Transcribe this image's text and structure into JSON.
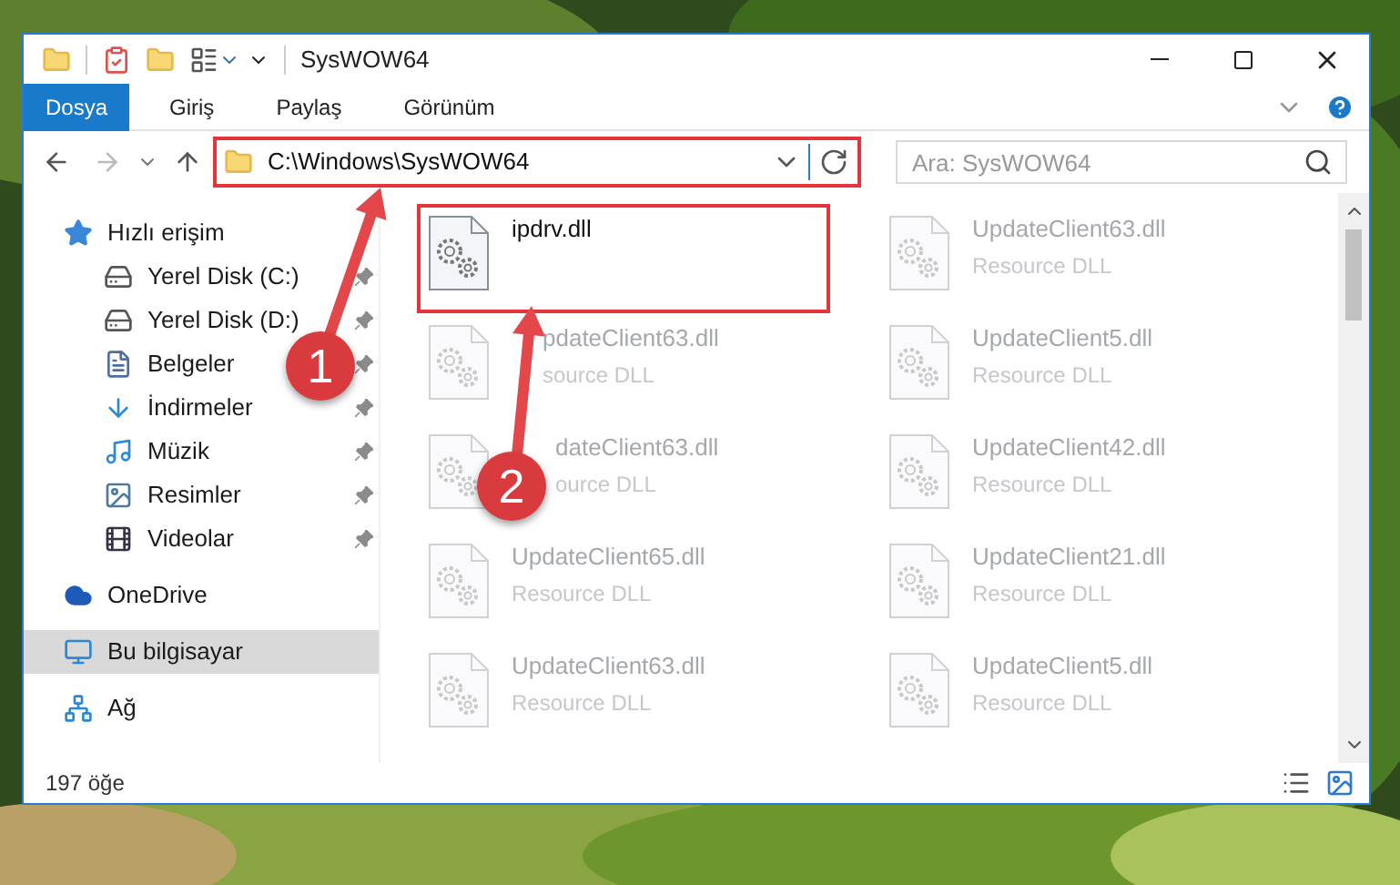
{
  "window": {
    "title": "SysWOW64"
  },
  "ribbon_tabs": [
    {
      "label": "Dosya",
      "selected": true
    },
    {
      "label": "Giriş",
      "selected": false
    },
    {
      "label": "Paylaş",
      "selected": false
    },
    {
      "label": "Görünüm",
      "selected": false
    }
  ],
  "address": {
    "path": "C:\\Windows\\SysWOW64",
    "highlighted": true
  },
  "search": {
    "placeholder": "Ara: SysWOW64"
  },
  "sidebar": {
    "items": [
      {
        "label": "Hızlı erişim",
        "kind": "star",
        "selected": false,
        "children": [
          {
            "label": "Yerel Disk (C:)",
            "kind": "drive_c",
            "selected": false,
            "pinned": true
          },
          {
            "label": "Yerel Disk (D:)",
            "kind": "drive",
            "selected": false,
            "pinned": true
          },
          {
            "label": "Belgeler",
            "kind": "documents",
            "selected": false,
            "pinned": true
          },
          {
            "label": "İndirmeler",
            "kind": "downloads",
            "selected": false,
            "pinned": true
          },
          {
            "label": "Müzik",
            "kind": "music",
            "selected": false,
            "pinned": true
          },
          {
            "label": "Resimler",
            "kind": "pictures",
            "selected": false,
            "pinned": true
          },
          {
            "label": "Videolar",
            "kind": "videos",
            "selected": false,
            "pinned": true
          }
        ]
      },
      {
        "label": "OneDrive",
        "kind": "cloud",
        "selected": false
      },
      {
        "label": "Bu bilgisayar",
        "kind": "computer",
        "selected": true
      },
      {
        "label": "Ağ",
        "kind": "network",
        "selected": false
      }
    ]
  },
  "files": [
    {
      "name": "ipdrv.dll",
      "highlighted": true,
      "faded": false
    },
    {
      "name": "UpdateClient63.dll",
      "type": "Resource DLL",
      "highlighted": false,
      "faded": true
    },
    {
      "name": "pdateClient63.dll",
      "type": "source DLL",
      "highlighted": false,
      "faded": true
    },
    {
      "name": "UpdateClient5.dll",
      "type": "Resource DLL",
      "highlighted": false,
      "faded": true
    },
    {
      "name": "dateClient63.dll",
      "type": "ource DLL",
      "highlighted": false,
      "faded": true
    },
    {
      "name": "UpdateClient42.dll",
      "type": "Resource DLL",
      "highlighted": false,
      "faded": true
    },
    {
      "name": "UpdateClient65.dll",
      "type": "Resource DLL",
      "highlighted": false,
      "faded": true
    },
    {
      "name": "UpdateClient21.dll",
      "type": "Resource DLL",
      "highlighted": false,
      "faded": true
    },
    {
      "name": "UpdateClient63.dll",
      "type": "Resource DLL",
      "highlighted": false,
      "faded": true
    },
    {
      "name": "UpdateClient5.dll",
      "type": "Resource DLL",
      "highlighted": false,
      "faded": true
    }
  ],
  "annotations": [
    {
      "number": "1"
    },
    {
      "number": "2"
    }
  ],
  "status_bar": {
    "count": "197 öğe"
  }
}
